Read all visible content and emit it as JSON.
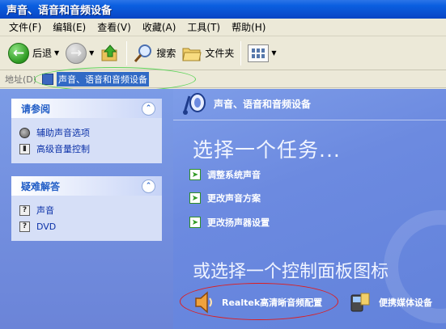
{
  "window": {
    "title": "声音、语音和音频设备"
  },
  "menu": [
    {
      "label": "文件(F)"
    },
    {
      "label": "编辑(E)"
    },
    {
      "label": "查看(V)"
    },
    {
      "label": "收藏(A)"
    },
    {
      "label": "工具(T)"
    },
    {
      "label": "帮助(H)"
    }
  ],
  "toolbar": {
    "back_label": "后退",
    "search_label": "搜索",
    "folders_label": "文件夹"
  },
  "address": {
    "label": "地址(D)",
    "value": "声音、语音和音频设备"
  },
  "sidebar": {
    "see_also": {
      "title": "请参阅",
      "items": [
        {
          "label": "辅助声音选项",
          "icon": "speaker-icon"
        },
        {
          "label": "高级音量控制",
          "icon": "volume-control-icon"
        }
      ]
    },
    "troubleshoot": {
      "title": "疑难解答",
      "items": [
        {
          "label": "声音",
          "icon": "help-icon"
        },
        {
          "label": "DVD",
          "icon": "help-icon"
        }
      ]
    }
  },
  "content": {
    "header_title": "声音、语音和音频设备",
    "task_heading": "选择一个任务...",
    "tasks": [
      {
        "label": "调整系统声音"
      },
      {
        "label": "更改声音方案"
      },
      {
        "label": "更改扬声器设置"
      }
    ],
    "cp_heading": "或选择一个控制面板图标",
    "cp_items": [
      {
        "label": "Realtek高清晰音频配置",
        "icon": "speaker-icon"
      },
      {
        "label": "便携媒体设备",
        "icon": "portable-media-icon"
      }
    ]
  },
  "colors": {
    "titlebar": "#0A50D0",
    "sidebar_bg": "#7A96DF",
    "content_bg": "#6C8AE0",
    "highlight_ellipse": "#E01C1C",
    "address_ellipse": "#5ED45A"
  }
}
